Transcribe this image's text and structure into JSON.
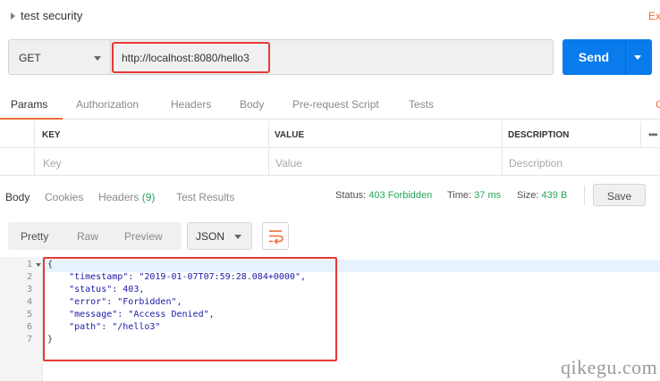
{
  "header": {
    "title": "test security",
    "right_text": "Ex"
  },
  "request": {
    "method": "GET",
    "url": "http://localhost:8080/hello3",
    "send_label": "Send"
  },
  "request_tabs": [
    {
      "label": "Params",
      "active": true
    },
    {
      "label": "Authorization"
    },
    {
      "label": "Headers"
    },
    {
      "label": "Body"
    },
    {
      "label": "Pre-request Script"
    },
    {
      "label": "Tests"
    }
  ],
  "request_tabs_right": "C",
  "params_table": {
    "columns": [
      "KEY",
      "VALUE",
      "DESCRIPTION"
    ],
    "more": "•••",
    "placeholders": {
      "key": "Key",
      "value": "Value",
      "description": "Description"
    }
  },
  "response_tabs": [
    {
      "label": "Body",
      "active": true
    },
    {
      "label": "Cookies"
    },
    {
      "label": "Headers",
      "count": "(9)"
    },
    {
      "label": "Test Results"
    }
  ],
  "status": {
    "status_label": "Status:",
    "status_value": "403 Forbidden",
    "time_label": "Time:",
    "time_value": "37 ms",
    "size_label": "Size:",
    "size_value": "439 B"
  },
  "save_label": "Save",
  "view_modes": [
    "Pretty",
    "Raw",
    "Preview"
  ],
  "format": "JSON",
  "code": {
    "line_numbers": [
      "1",
      "2",
      "3",
      "4",
      "5",
      "6",
      "7"
    ],
    "lines": [
      "{",
      "    \"timestamp\": \"2019-01-07T07:59:28.084+0000\",",
      "    \"status\": 403,",
      "    \"error\": \"Forbidden\",",
      "    \"message\": \"Access Denied\",",
      "    \"path\": \"/hello3\"",
      "}"
    ]
  },
  "watermark": "qikegu.com",
  "colors": {
    "accent": "#f26b3a",
    "send": "#097bed",
    "status_ok": "#26a65b",
    "highlight": "#e53935"
  },
  "icons": {
    "collapse": "caret-right-icon",
    "dropdown": "chevron-down-icon",
    "wrap": "wrap-lines-icon",
    "more": "more-icon"
  }
}
